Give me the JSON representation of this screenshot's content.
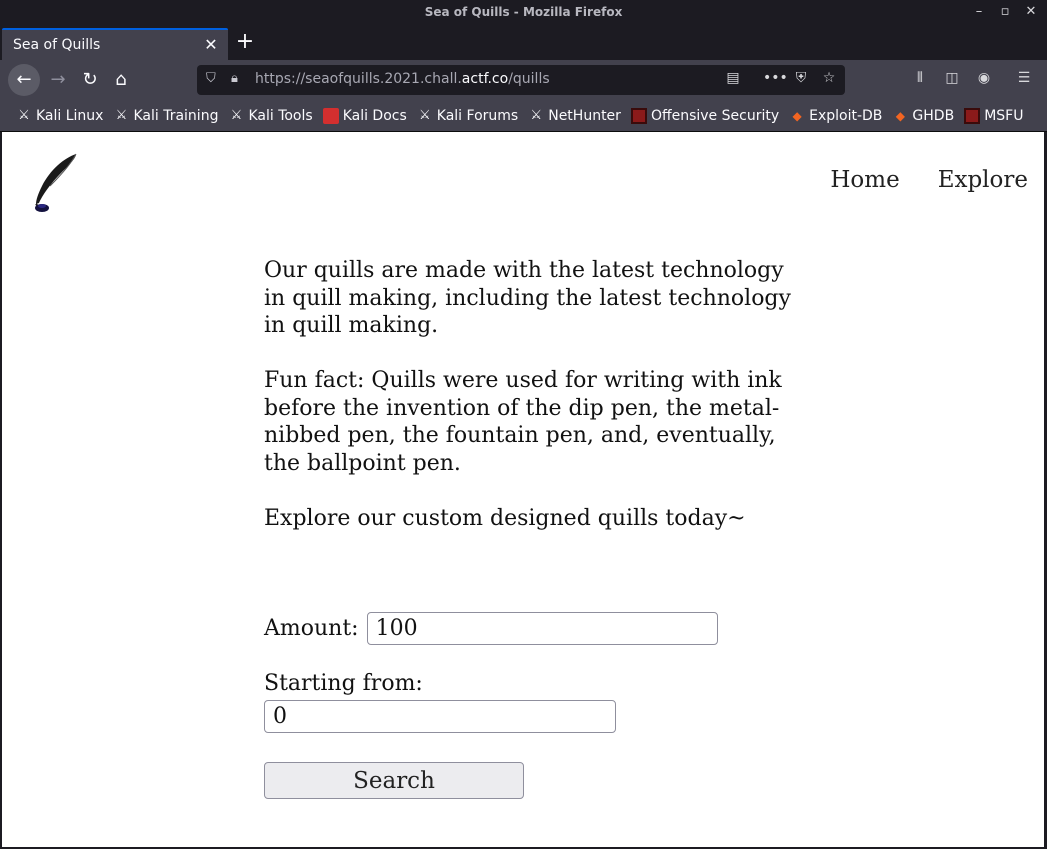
{
  "window": {
    "title": "Sea of Quills - Mozilla Firefox",
    "controls": {
      "minimize": "–",
      "maximize": "▫",
      "close": "✕"
    }
  },
  "tab": {
    "title": "Sea of Quills",
    "close": "✕",
    "new_tab": "+"
  },
  "navbar": {
    "url_prefix": "https://seaofquills.2021.chall.",
    "url_domain": "actf.co",
    "url_suffix": "/quills",
    "icons": [
      "back-icon",
      "forward-icon",
      "reload-icon",
      "home-icon",
      "shield-icon",
      "lock-icon",
      "reader-view-icon",
      "more-icon",
      "pocket-icon",
      "star-icon",
      "library-icon",
      "sidebar-icon",
      "account-icon",
      "menu-icon"
    ]
  },
  "bookmarks": [
    {
      "label": "Kali Linux",
      "icon": "kali"
    },
    {
      "label": "Kali Training",
      "icon": "kali"
    },
    {
      "label": "Kali Tools",
      "icon": "kali"
    },
    {
      "label": "Kali Docs",
      "icon": "docs"
    },
    {
      "label": "Kali Forums",
      "icon": "kali"
    },
    {
      "label": "NetHunter",
      "icon": "kali"
    },
    {
      "label": "Offensive Security",
      "icon": "offsec"
    },
    {
      "label": "Exploit-DB",
      "icon": "exploit"
    },
    {
      "label": "GHDB",
      "icon": "exploit"
    },
    {
      "label": "MSFU",
      "icon": "offsec"
    }
  ],
  "page": {
    "nav": {
      "home": "Home",
      "explore": "Explore"
    },
    "paragraphs": [
      "Our quills are made with the latest technology in quill making, including the latest technology in quill making.",
      "Fun fact: Quills were used for writing with ink before the invention of the dip pen, the metal-nibbed pen, the fountain pen, and, eventually, the ballpoint pen.",
      "Explore our custom designed quills today~"
    ],
    "form": {
      "amount_label": "Amount:",
      "amount_value": "100",
      "start_label": "Starting from:",
      "start_value": "0",
      "search_label": "Search"
    }
  }
}
